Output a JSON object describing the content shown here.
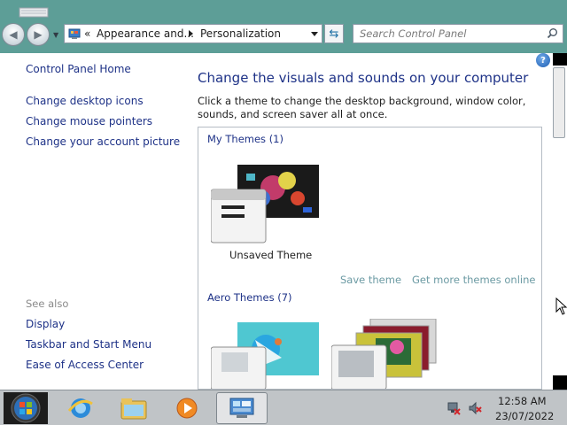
{
  "window": {
    "breadcrumb_prefix": "«",
    "breadcrumbs": [
      "Appearance and...",
      "Personalization"
    ],
    "search_placeholder": "Search Control Panel"
  },
  "sidebar": {
    "home": "Control Panel Home",
    "tasks": [
      "Change desktop icons",
      "Change mouse pointers",
      "Change your account picture"
    ],
    "see_also_label": "See also",
    "see_also": [
      "Display",
      "Taskbar and Start Menu",
      "Ease of Access Center"
    ]
  },
  "main": {
    "heading": "Change the visuals and sounds on your computer",
    "description": "Click a theme to change the desktop background, window color, sounds, and screen saver all at once.",
    "my_themes_label": "My Themes (1)",
    "unsaved_theme": "Unsaved Theme",
    "save_theme": "Save theme",
    "get_more": "Get more themes online",
    "aero_themes_label": "Aero Themes (7)"
  },
  "taskbar": {
    "apps": [
      "internet-explorer-icon",
      "file-explorer-icon",
      "media-player-icon",
      "control-panel-icon"
    ],
    "time": "12:58 AM",
    "date": "23/07/2022"
  },
  "colors": {
    "title_bar": "#5d9e97",
    "link": "#1e3287",
    "taskbar": "#c0c4c7"
  }
}
